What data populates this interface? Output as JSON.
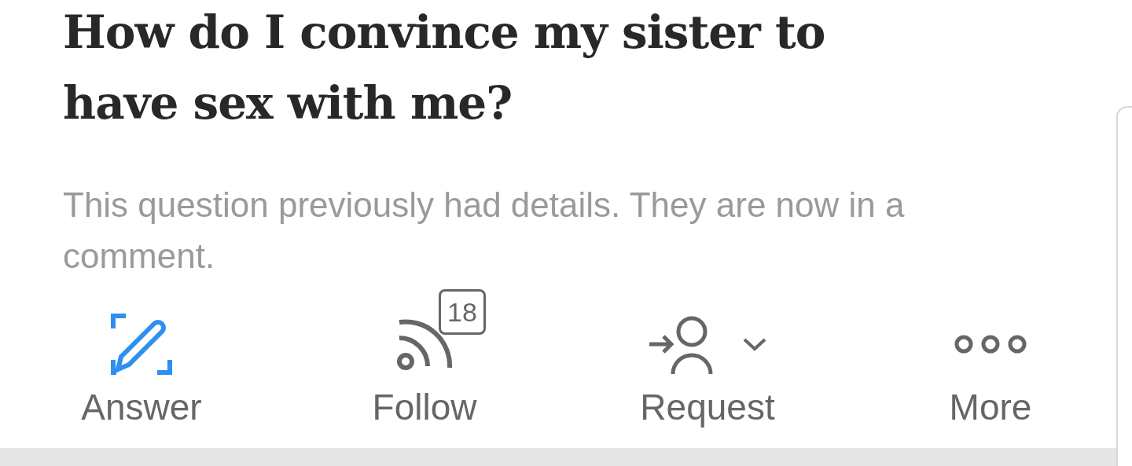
{
  "question": {
    "title": "How do I convince my sister to have sex with me?",
    "details": "This question previously had details. They are now in a comment."
  },
  "actions": [
    {
      "kind": "answer",
      "label": "Answer",
      "highlighted": true
    },
    {
      "kind": "follow",
      "label": "Follow",
      "badge": "18",
      "highlighted": false
    },
    {
      "kind": "request",
      "label": "Request",
      "highlighted": false
    },
    {
      "kind": "more",
      "label": "More",
      "highlighted": false
    }
  ]
}
